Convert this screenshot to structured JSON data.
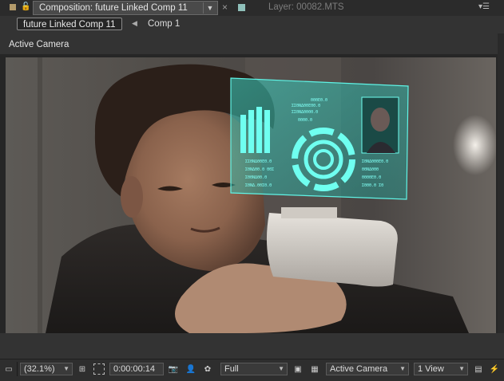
{
  "tabs": {
    "composition_label": "Composition: future Linked Comp 11",
    "layer_label": "Layer: 00082.MTS"
  },
  "breadcrumbs": [
    {
      "label": "future Linked Comp 11"
    },
    {
      "label": "Comp 1"
    }
  ],
  "viewer": {
    "title": "Active Camera"
  },
  "toolbar": {
    "zoom": "(32.1%)",
    "timecode": "0:00:00:14",
    "resolution": "Full",
    "view": "Active Camera",
    "layout": "1 View"
  },
  "hologram": {
    "left_text": [
      "ΣΣΘΝΔΘΘΕΘ.Θ",
      "ΣΘΝΔΘΘ.Θ ΘΘΣ",
      "ΣΘΘΝΔΘΘ.Θ",
      "ΣΘΝΔ.ΘΘΣΘ.Θ"
    ],
    "top_text": [
      "ΘΘΘΕΘ.Θ",
      "ΣΣΘΝΔΘΘΕΘΘ.Θ",
      "ΣΣΘΝΔΘΘΘΘ.Θ",
      "ΘΘΘΘ.Θ"
    ],
    "right_text": [
      "ΣΘΝΔΘΘΘΕΘ.Θ",
      "ΘΘΝΔΘΘΘ",
      "ΘΘΘΘΕΘ.Θ",
      "ΣΘΘΘ.Θ ΣΘ"
    ]
  },
  "colors": {
    "accent": "#9edbd3",
    "hologram": "#40f5e8"
  }
}
